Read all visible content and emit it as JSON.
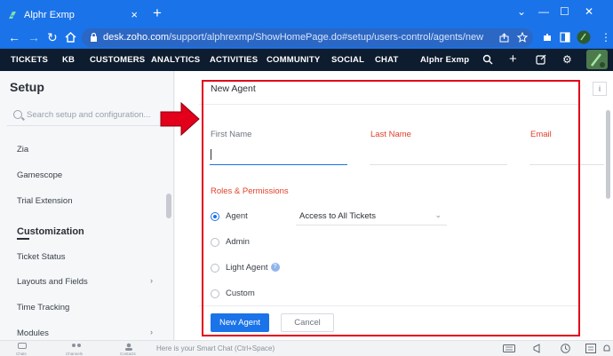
{
  "browser": {
    "tab_title": "Alphr Exmp",
    "tab_close": "×",
    "new_tab": "+",
    "window_controls": [
      "⌄",
      "—",
      "☐",
      "✕"
    ],
    "url_domain": "desk.zoho.com",
    "url_path": "/support/alphrexmp/ShowHomePage.do#setup/users-control/agents/new",
    "nav": {
      "back": "←",
      "forward": "→",
      "reload": "↻"
    }
  },
  "appnav": {
    "items": [
      "TICKETS",
      "KB",
      "CUSTOMERS",
      "ANALYTICS",
      "ACTIVITIES",
      "COMMUNITY",
      "SOCIAL",
      "CHAT"
    ],
    "org": "Alphr Exmp",
    "icons": {
      "search": "⌕",
      "add": "+",
      "gear": "⚙"
    }
  },
  "sidebar": {
    "title": "Setup",
    "search_placeholder": "Search setup and configuration...",
    "items_top": [
      "Zia",
      "Gamescope",
      "Trial Extension"
    ],
    "section": "Customization",
    "items_section": [
      "Ticket Status",
      "Layouts and Fields",
      "Time Tracking",
      "Modules"
    ],
    "chevron": "›"
  },
  "form": {
    "title": "New Agent",
    "info": "i",
    "first_name_label": "First Name",
    "last_name_label": "Last Name",
    "email_label": "Email",
    "roles_label": "Roles & Permissions",
    "roles": [
      "Agent",
      "Admin",
      "Light Agent",
      "Custom"
    ],
    "selected_role": "Agent",
    "help": "?",
    "profile_select": "Access to All Tickets",
    "select_arrow": "⌄",
    "submit": "New Agent",
    "cancel": "Cancel"
  },
  "colors": {
    "browser": "#1a73e8",
    "appnav": "#0e1c2f",
    "required_label": "#e0412b",
    "primary": "#1a73e8",
    "annotation": "#e2001a"
  },
  "bottombar": {
    "labels": [
      "Chats",
      "Channels",
      "Contacts"
    ],
    "smart_chat": "Here is your Smart Chat (Ctrl+Space)"
  }
}
